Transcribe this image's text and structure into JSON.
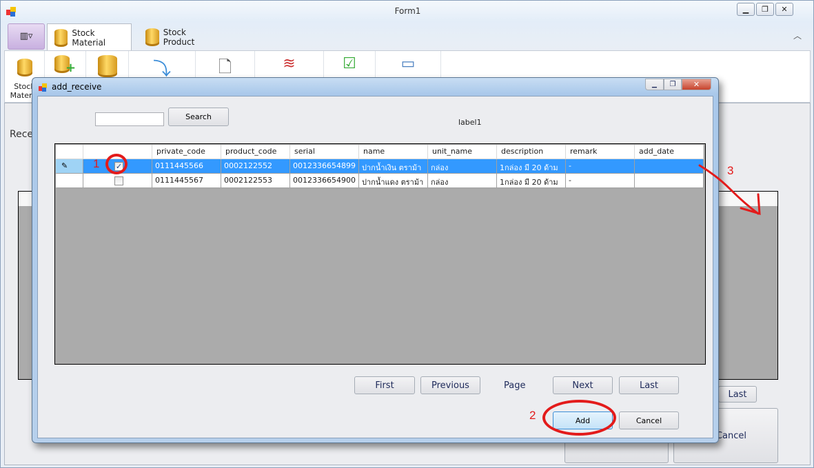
{
  "window": {
    "title": "Form1",
    "controls": [
      "minimize",
      "maximize",
      "close"
    ]
  },
  "ribbon": {
    "tabs": [
      {
        "label": "Stock Material",
        "active": true
      },
      {
        "label": "Stock Product",
        "active": false
      }
    ],
    "visible_label": "Stock Materia"
  },
  "main": {
    "heading": "Rece",
    "last_label": "Last",
    "cancel_label": "Cancel"
  },
  "dialog": {
    "title": "add_receive",
    "search": {
      "value": "",
      "button": "Search"
    },
    "label1": "label1",
    "grid": {
      "columns": [
        "",
        "private_code",
        "product_code",
        "serial",
        "name",
        "unit_name",
        "description",
        "remark",
        "add_date"
      ],
      "rows": [
        {
          "checked": true,
          "selected": true,
          "cells": [
            "0111445566",
            "0002122552",
            "0012336654899",
            "ปากน้ำเงิน ตราม้า",
            "กล่อง",
            "1กล่อง มี 20 ด้าม",
            "-",
            ""
          ]
        },
        {
          "checked": false,
          "selected": false,
          "cells": [
            "0111445567",
            "0002122553",
            "0012336654900",
            "ปากน้ำแดง ตราม้า",
            "กล่อง",
            "1กล่อง มี 20 ด้าม",
            "-",
            ""
          ]
        }
      ]
    },
    "pager": {
      "first": "First",
      "previous": "Previous",
      "page": "Page",
      "next": "Next",
      "last": "Last"
    },
    "add_label": "Add",
    "cancel_label": "Cancel"
  },
  "annotations": {
    "one": "1",
    "two": "2",
    "three": "3"
  }
}
